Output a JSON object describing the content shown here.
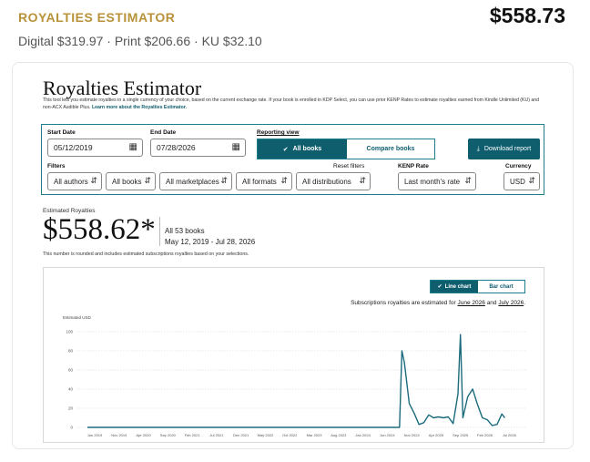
{
  "header": {
    "title": "ROYALTIES ESTIMATOR",
    "total": "$558.73",
    "breakdown": "Digital $319.97 · Print $206.66 · KU $32.10"
  },
  "estimator": {
    "title": "Royalties Estimator",
    "description": "This tool lets you estimate royalties in a single currency of your choice, based on the current exchange rate. If your book is enrolled in KDP Select, you can use prior KENP Rates to estimate royalties earned from Kindle Unlimited (KU) and non-ACX Audible Plus.",
    "learn_more": "Learn more about the Royalties Estimator.",
    "start_date_label": "Start Date",
    "start_date": "05/12/2019",
    "end_date_label": "End Date",
    "end_date": "07/28/2026",
    "reporting_view_label": "Reporting view",
    "all_books_label": "All books",
    "compare_books_label": "Compare books",
    "download_label": "Download report",
    "filters_label": "Filters",
    "reset_filters_label": "Reset filters",
    "kenp_rate_label": "KENP Rate",
    "currency_label": "Currency",
    "filters": {
      "authors": "All authors",
      "books": "All books",
      "marketplaces": "All marketplaces",
      "formats": "All formats",
      "distributions": "All distributions",
      "kenp_rate": "Last month's rate",
      "currency": "USD"
    },
    "estimated_label": "Estimated Royalties",
    "estimated_value": "$558.62*",
    "books_count": "All 53 books",
    "date_range": "May 12, 2019 - Jul 28, 2026",
    "note": "This number is rounded and includes estimated subscriptions royalties based on your selections."
  },
  "chart_panel": {
    "line_chart_label": "Line chart",
    "bar_chart_label": "Bar chart",
    "note_prefix": "Subscriptions royalties are estimated for",
    "note_month1": "June 2026",
    "note_and": "and",
    "note_month2": "July 2026",
    "note_suffix": "."
  },
  "chart_data": {
    "type": "line",
    "ylabel": "Estimated USD",
    "ylim": [
      0,
      100
    ],
    "yticks": [
      0,
      20,
      40,
      60,
      80,
      100
    ],
    "xtick_labels": [
      "Jun 2019",
      "Nov 2019",
      "Apr 2020",
      "Sep 2020",
      "Feb 2021",
      "Jul 2021",
      "Dec 2021",
      "May 2022",
      "Oct 2022",
      "Mar 2023",
      "Aug 2023",
      "Jan 2024",
      "Jun 2024",
      "Nov 2024",
      "Apr 2025",
      "Sep 2025",
      "Feb 2026",
      "Jul 2026"
    ],
    "color": "#1b6b7c",
    "grid": true,
    "x": [
      0,
      60,
      64,
      64.5,
      65,
      66,
      67,
      68,
      69,
      70,
      71,
      72,
      73,
      74,
      75,
      76,
      76.5,
      77,
      78,
      79,
      80,
      81,
      82,
      83,
      84,
      85,
      85.6
    ],
    "values": [
      0,
      0,
      0,
      80,
      68,
      25,
      15,
      3,
      5,
      13,
      10,
      11,
      10,
      11,
      4,
      35,
      97,
      10,
      32,
      40,
      24,
      10,
      8,
      2,
      3,
      14,
      10
    ]
  }
}
